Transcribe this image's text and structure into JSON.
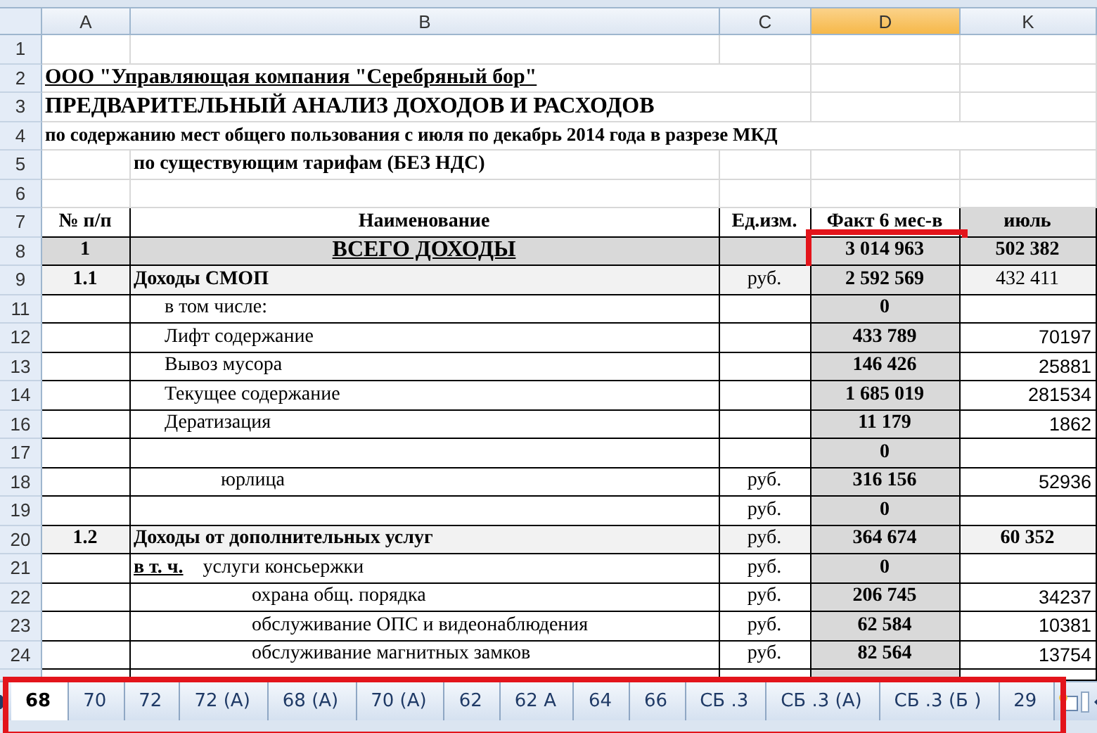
{
  "columns": [
    {
      "label": "A",
      "selected": false
    },
    {
      "label": "B",
      "selected": false
    },
    {
      "label": "C",
      "selected": false
    },
    {
      "label": "D",
      "selected": true
    },
    {
      "label": "K",
      "selected": false
    }
  ],
  "rows": [
    {
      "number": "1",
      "kind": "blank"
    },
    {
      "number": "2",
      "kind": "org",
      "a": "ООО \"Управляющая компания \"Серебряный бор\""
    },
    {
      "number": "3",
      "kind": "title",
      "a": "ПРЕДВАРИТЕЛЬНЫЙ АНАЛИЗ ДОХОДОВ И РАСХОДОВ"
    },
    {
      "number": "4",
      "kind": "subtitle",
      "a": "по содержанию мест общего пользования с июля по декабрь 2014 года в разрезе МКД"
    },
    {
      "number": "5",
      "kind": "note",
      "b": "по существующим тарифам (БЕЗ НДС)"
    },
    {
      "number": "6",
      "kind": "blank"
    },
    {
      "number": "7",
      "kind": "header",
      "a": "№ п/п",
      "b": "Наименование",
      "c": "Ед.изм.",
      "d": "Факт 6 мес-в",
      "k": "июль"
    },
    {
      "number": "8",
      "kind": "total",
      "a": "1",
      "b": "ВСЕГО  ДОХОДЫ",
      "d": "3 014 963",
      "k": "502 382",
      "k_bold": true,
      "d_highlighted": true
    },
    {
      "number": "9",
      "kind": "section",
      "a": "1.1",
      "b": "Доходы СМОП",
      "c": "руб.",
      "d": "2 592 569",
      "k": "432 411",
      "k_bold": false,
      "d_highlighted": false
    },
    {
      "number": "11",
      "kind": "item",
      "b": "в том числе:",
      "d": "0"
    },
    {
      "number": "12",
      "kind": "item",
      "b": "Лифт содержание",
      "d": "433 789",
      "k": "70197"
    },
    {
      "number": "13",
      "kind": "item",
      "b": "Вывоз мусора",
      "d": "146 426",
      "k": "25881"
    },
    {
      "number": "14",
      "kind": "item",
      "b": "Текущее содержание",
      "d": "1 685 019",
      "k": "281534"
    },
    {
      "number": "16",
      "kind": "item",
      "b": "Дератизация",
      "d": "11 179",
      "k": "1862"
    },
    {
      "number": "17",
      "kind": "item",
      "d": "0"
    },
    {
      "number": "18",
      "kind": "subitem",
      "b": "юрлица",
      "c": "руб.",
      "d": "316 156",
      "k": "52936"
    },
    {
      "number": "19",
      "kind": "item",
      "c": "руб.",
      "d": "0"
    },
    {
      "number": "20",
      "kind": "section",
      "a": "1.2",
      "b": "Доходы от дополнительных услуг",
      "c": "руб.",
      "d": "364 674",
      "k": "60 352",
      "k_bold": true,
      "d_highlighted": false
    },
    {
      "number": "21",
      "kind": "lead",
      "prefix": "в т. ч.",
      "b": "услуги консьержки",
      "c": "руб.",
      "d": "0"
    },
    {
      "number": "22",
      "kind": "detail",
      "b": "охрана общ. порядка",
      "c": "руб.",
      "d": "206 745",
      "k": "34237"
    },
    {
      "number": "23",
      "kind": "detail",
      "b": "обслуживание ОПС и видеонаблюдения",
      "c": "руб.",
      "d": "62 584",
      "k": "10381"
    },
    {
      "number": "24",
      "kind": "detail",
      "b": "обслуживание магнитных замков",
      "c": "руб.",
      "d": "82 564",
      "k": "13754"
    }
  ],
  "sheet_tabs": {
    "highlighted": true,
    "tabs": [
      {
        "label": "68",
        "selected": true
      },
      {
        "label": "70",
        "selected": false
      },
      {
        "label": "72",
        "selected": false
      },
      {
        "label": "72 (A)",
        "selected": false
      },
      {
        "label": "68 (A)",
        "selected": false
      },
      {
        "label": "70 (A)",
        "selected": false
      },
      {
        "label": "62",
        "selected": false
      },
      {
        "label": "62  A",
        "selected": false
      },
      {
        "label": "64",
        "selected": false
      },
      {
        "label": "66",
        "selected": false
      },
      {
        "label": "СБ .3",
        "selected": false
      },
      {
        "label": "СБ .3 (А)",
        "selected": false
      },
      {
        "label": "СБ .3 (Б )",
        "selected": false
      },
      {
        "label": "29",
        "selected": false
      }
    ]
  }
}
